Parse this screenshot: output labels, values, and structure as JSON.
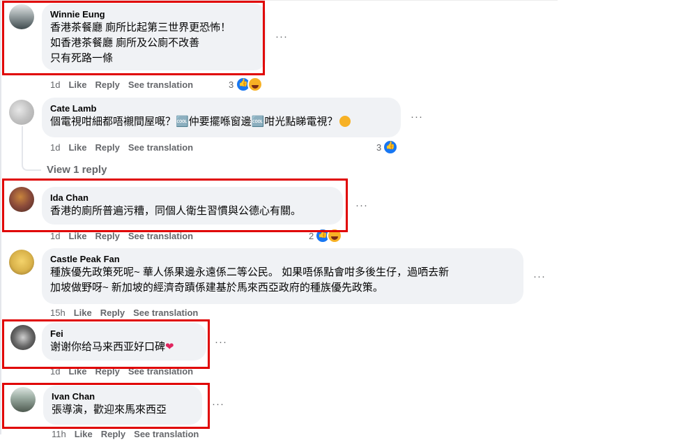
{
  "comments": [
    {
      "author": "Winnie Eung",
      "lines": [
        "香港茶餐廳 廁所比起第三世界更恐怖！",
        "如香港茶餐廳 廁所及公廁不改善",
        "只有死路一條"
      ],
      "time": "1d",
      "like": "Like",
      "reply": "Reply",
      "translate": "See translation",
      "reaction_count": "3",
      "reactions": [
        "like-icon",
        "haha-icon"
      ],
      "avatar_color": "#5b6a6e"
    },
    {
      "author": "Cate Lamb",
      "lines": [
        "個電視咁細都唔襯間屋嘅？🆒仲要擺喺窗邊🆒咁光點睇電視？"
      ],
      "time": "1d",
      "like": "Like",
      "reply": "Reply",
      "translate": "See translation",
      "reaction_count": "3",
      "reactions": [
        "like-icon"
      ],
      "view_replies": "View 1 reply",
      "avatar_color": "#b9b9b9"
    },
    {
      "author": "Ida Chan",
      "lines": [
        "香港的廁所普遍污糟，同個人衛生習慣與公德心有關。"
      ],
      "time": "1d",
      "like": "Like",
      "reply": "Reply",
      "translate": "See translation",
      "reaction_count": "2",
      "reactions": [
        "like-icon",
        "haha-icon"
      ],
      "avatar_color": "#8a4a3a"
    },
    {
      "author": "Castle Peak Fan",
      "lines": [
        "種族優先政策死呢~ 華人係果邊永遠係二等公民。 如果唔係點會咁多後生仔，過哂去新",
        "加坡做野呀~ 新加坡的經濟奇蹟係建基於馬來西亞政府的種族優先政策。"
      ],
      "time": "15h",
      "like": "Like",
      "reply": "Reply",
      "translate": "See translation",
      "avatar_color": "#d9b24a"
    },
    {
      "author": "Fei",
      "lines": [
        "谢谢你给马来西亚好口碑"
      ],
      "time": "1d",
      "like": "Like",
      "reply": "Reply",
      "translate": "See translation",
      "avatar_color": "#444444"
    },
    {
      "author": "Ivan Chan",
      "lines": [
        "張導演，歡迎來馬來西亞"
      ],
      "time": "11h",
      "like": "Like",
      "reply": "Reply",
      "translate": "See translation",
      "avatar_color": "#6f7a6e"
    }
  ],
  "more_label": "···",
  "highlight_color": "#e00000"
}
